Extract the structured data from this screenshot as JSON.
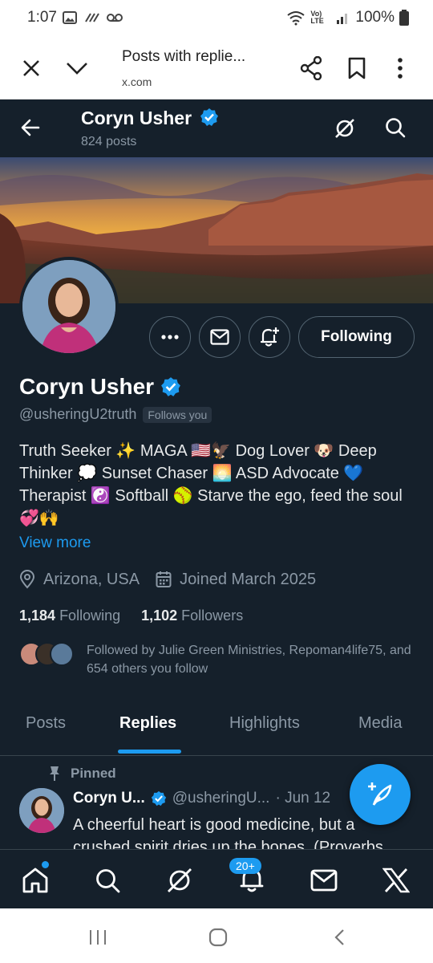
{
  "status_bar": {
    "time": "1:07",
    "battery": "100%",
    "network": "Vo) LTE"
  },
  "browser": {
    "page_title": "Posts with replie...",
    "url": "x.com"
  },
  "header": {
    "name": "Coryn Usher",
    "post_count": "824 posts"
  },
  "profile": {
    "name": "Coryn Usher",
    "handle": "@usheringU2truth",
    "follows_you": "Follows you",
    "following_button": "Following",
    "bio": "Truth Seeker ✨ MAGA 🇺🇸🦅 Dog Lover 🐶 Deep Thinker 💭 Sunset Chaser 🌅 ASD Advocate 💙 Therapist ☯️ Softball 🥎 Starve the ego, feed the soul 💞🙌",
    "view_more": "View more",
    "location": "Arizona, USA",
    "joined": "Joined March 2025",
    "following_count": "1,184",
    "following_label": "Following",
    "followers_count": "1,102",
    "followers_label": "Followers",
    "followed_by": "Followed by Julie Green Ministries, Repoman4life75, and 654 others you follow"
  },
  "tabs": [
    {
      "label": "Posts"
    },
    {
      "label": "Replies"
    },
    {
      "label": "Highlights"
    },
    {
      "label": "Media"
    }
  ],
  "pinned_post": {
    "pinned_label": "Pinned",
    "author": "Coryn U...",
    "handle": "@usheringU...",
    "date": "· Jun 12",
    "text": "A cheerful heart is good medicine, but a crushed spirit dries up the bones. (Proverbs"
  },
  "bottom_nav": {
    "notifications_badge": "20+"
  },
  "colors": {
    "accent": "#1d9bf0",
    "background": "#15202b",
    "muted": "#8b98a5"
  }
}
